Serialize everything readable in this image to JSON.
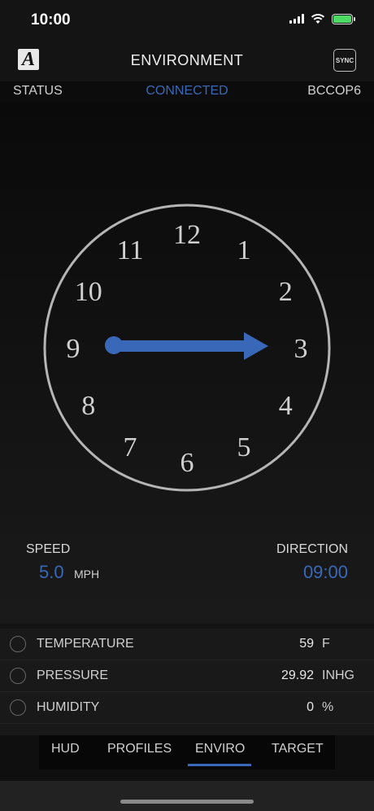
{
  "status_bar": {
    "time": "10:00"
  },
  "nav": {
    "logo_letter": "A",
    "title": "ENVIRONMENT",
    "sync_label": "SYNC"
  },
  "connection": {
    "status_label": "STATUS",
    "status_value": "CONNECTED",
    "device": "BCCOP6"
  },
  "dial": {
    "numbers": [
      "12",
      "1",
      "2",
      "3",
      "4",
      "5",
      "6",
      "7",
      "8",
      "9",
      "10",
      "11"
    ],
    "arrow_clock_position": "09:00",
    "arrow_color": "#3a68b8"
  },
  "wind": {
    "speed_label": "SPEED",
    "speed_value": "5.0",
    "speed_unit": "MPH",
    "direction_label": "DIRECTION",
    "direction_value": "09:00"
  },
  "environment": [
    {
      "name": "TEMPERATURE",
      "value": "59",
      "unit": "F"
    },
    {
      "name": "PRESSURE",
      "value": "29.92",
      "unit": "INHG"
    },
    {
      "name": "HUMIDITY",
      "value": "0",
      "unit": "%"
    }
  ],
  "tabs": [
    {
      "label": "HUD"
    },
    {
      "label": "PROFILES"
    },
    {
      "label": "ENVIRO",
      "active": true
    },
    {
      "label": "TARGET"
    }
  ],
  "colors": {
    "accent": "#3a68b8",
    "background": "#141414",
    "battery": "#4cd964"
  }
}
